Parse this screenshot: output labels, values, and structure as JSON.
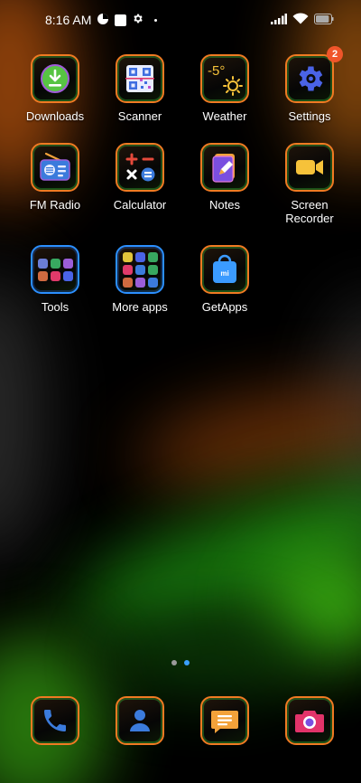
{
  "status_bar": {
    "time": "8:16 AM",
    "battery_level": 0.9,
    "icons": [
      "data-saver-icon",
      "square-notification-icon",
      "gear-icon",
      "dot-icon",
      "signal-icon",
      "wifi-icon",
      "battery-icon"
    ]
  },
  "apps": [
    {
      "label": "Downloads",
      "icon": "download-icon"
    },
    {
      "label": "Scanner",
      "icon": "qr-code-icon"
    },
    {
      "label": "Weather",
      "icon": "weather-icon",
      "icon_text": "-5°"
    },
    {
      "label": "Settings",
      "icon": "gear-icon",
      "badge": "2"
    },
    {
      "label": "FM Radio",
      "icon": "radio-icon"
    },
    {
      "label": "Calculator",
      "icon": "calculator-icon"
    },
    {
      "label": "Notes",
      "icon": "notes-icon"
    },
    {
      "label": "Screen\nRecorder",
      "icon": "video-camera-icon"
    },
    {
      "label": "Tools",
      "icon": "folder-icon"
    },
    {
      "label": "More apps",
      "icon": "folder-icon"
    },
    {
      "label": "GetApps",
      "icon": "shopping-bag-icon",
      "icon_text": "mi"
    }
  ],
  "page_indicator": {
    "pages": 2,
    "current": 2
  },
  "dock": [
    {
      "icon": "phone-icon"
    },
    {
      "icon": "contacts-icon"
    },
    {
      "icon": "messages-icon"
    },
    {
      "icon": "camera-icon"
    }
  ],
  "colors": {
    "icon_border": "#f07a22",
    "folder_border": "#2b8fff",
    "badge": "#f0552a",
    "active_dot": "#3aa0ff"
  }
}
